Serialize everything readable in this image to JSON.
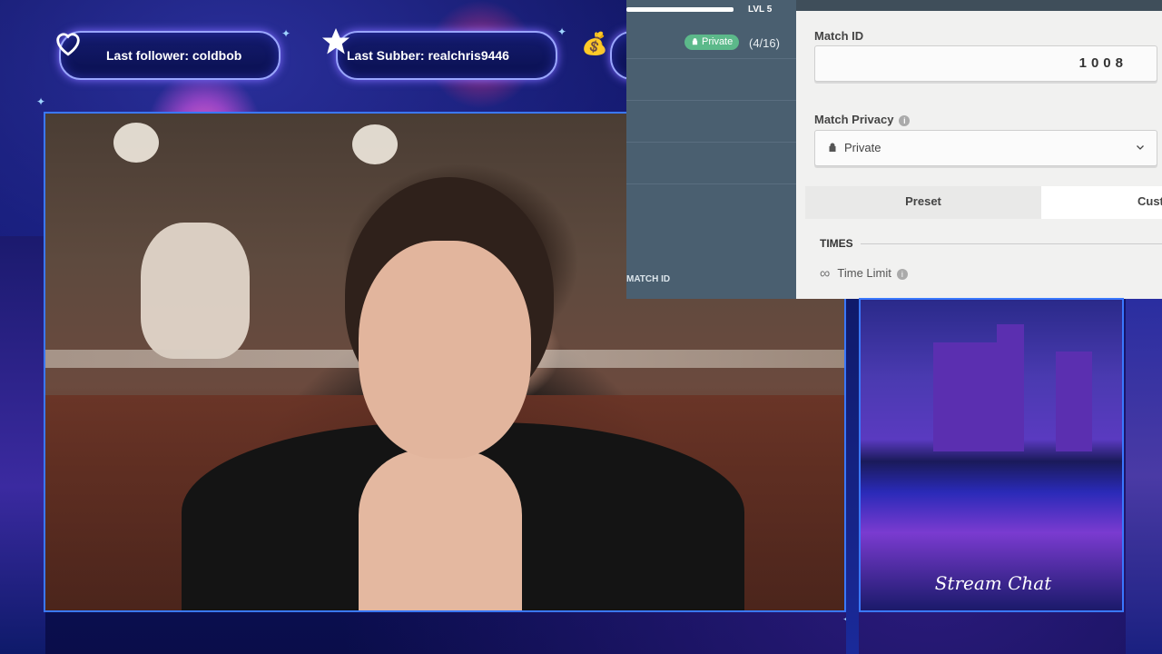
{
  "overlay": {
    "follower_text": "Last follower: coldbob",
    "subber_text": "Last Subber: realchris9446",
    "chat_title": "Stream Chat"
  },
  "icons": {
    "follower": "heart-icon",
    "subber": "star-icon",
    "donation": "moneybag-icon"
  },
  "game_panel": {
    "level": "LVL 5",
    "lobby_badge": "Private",
    "lobby_count": "(4/16)",
    "left_match_id_label": "MATCH ID",
    "match_id_label": "Match ID",
    "match_id_value": "1008",
    "match_privacy_label": "Match Privacy",
    "match_privacy_value": "Private",
    "tabs": [
      "Preset",
      "Cust"
    ],
    "section_times": "TIMES",
    "time_limit_label": "Time Limit"
  },
  "colors": {
    "frame_border": "#3a78ff",
    "private_badge": "#5cb98a"
  }
}
